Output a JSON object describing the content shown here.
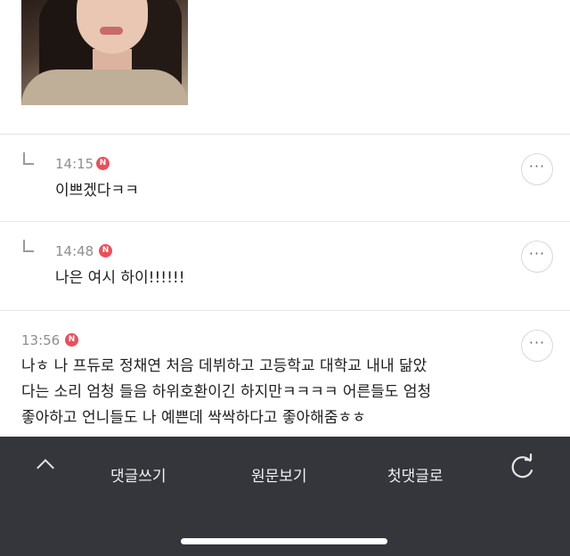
{
  "comments": [
    {
      "time": "14:15",
      "badge": "N",
      "text": "이쁘겠다ㅋㅋ",
      "more": "···"
    },
    {
      "time": "14:48",
      "badge": "N",
      "text": "나은 여시 하이!!!!!!",
      "more": "···"
    },
    {
      "time": "13:56",
      "badge": "N",
      "lines": [
        "나ㅎ 나 프듀로 정채연 처음 데뷔하고 고등학교 대학교 내내 닮았",
        "다는 소리 엄청 들음 하위호환이긴 하지만ㅋㅋㅋㅋ 어른들도 엄청",
        "좋아하고 언니들도 나 예쁜데 싹싹하다고 좋아해줌ㅎㅎ"
      ],
      "more": "···"
    }
  ],
  "bottom_bar": {
    "write_comment": "댓글쓰기",
    "view_original": "원문보기",
    "first_comment": "첫댓글로"
  },
  "icons": {
    "up": "chevron-up-icon",
    "refresh": "refresh-icon",
    "reply": "reply-arrow-icon"
  },
  "colors": {
    "badge": "#e8505b",
    "bar": "#34363c"
  }
}
